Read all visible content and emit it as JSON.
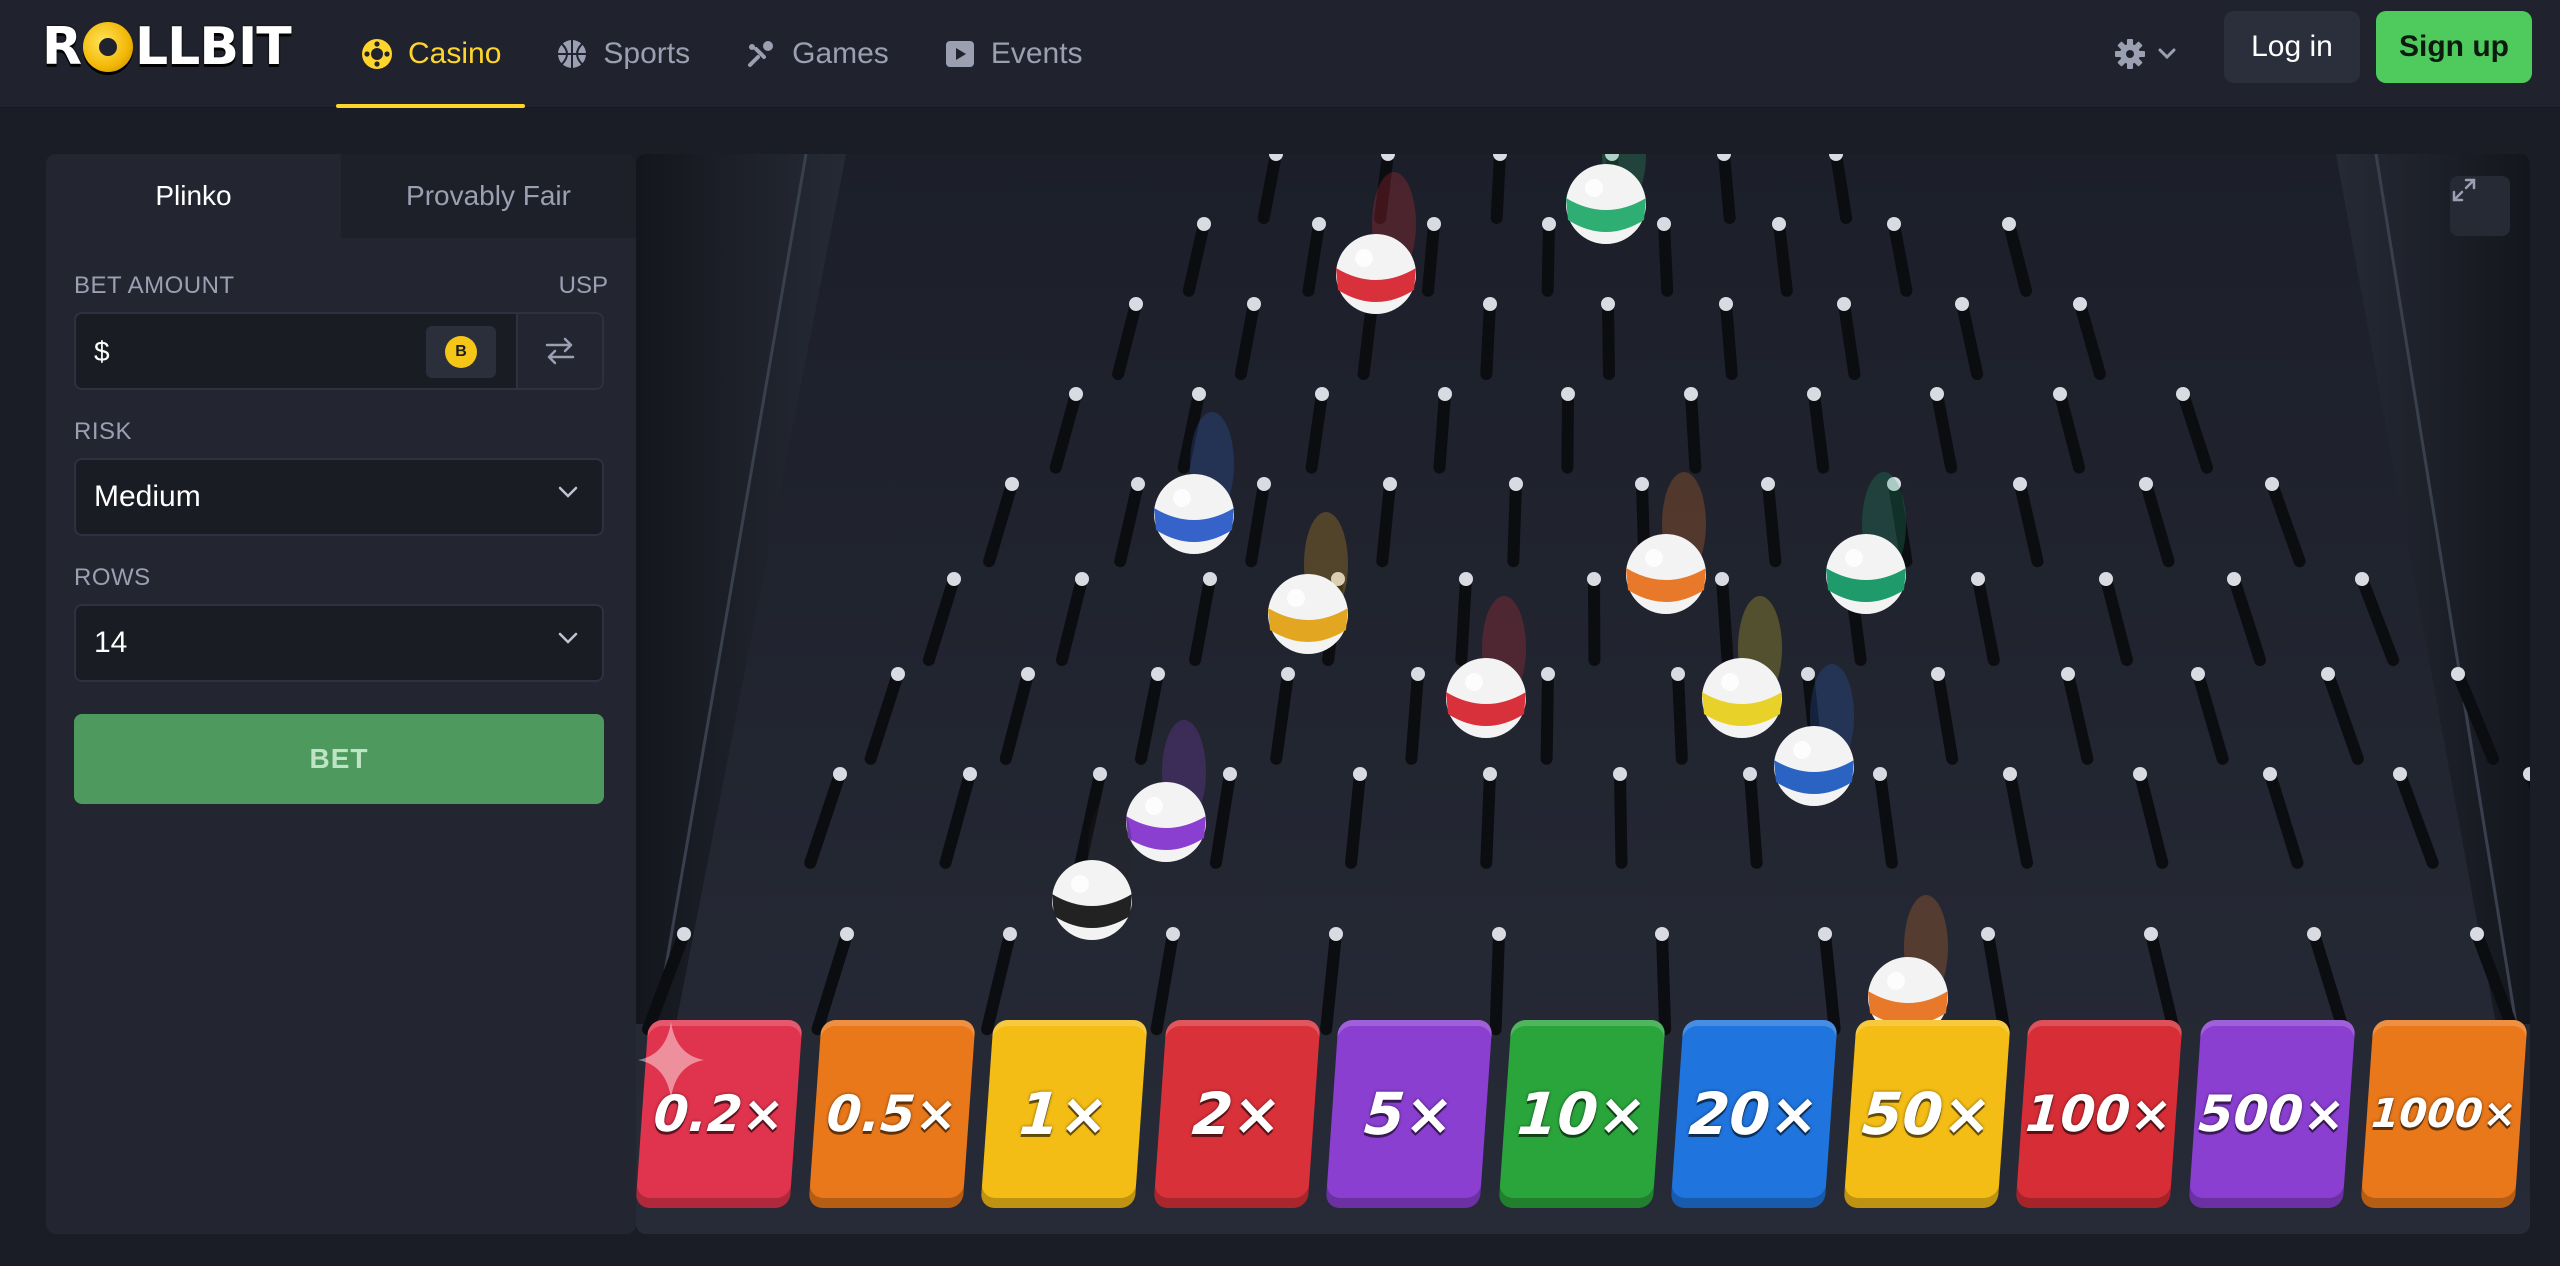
{
  "header": {
    "logo": "ROLLBIT",
    "nav": [
      {
        "label": "Casino",
        "icon": "casino-chip-icon",
        "active": true
      },
      {
        "label": "Sports",
        "icon": "basketball-icon",
        "active": false
      },
      {
        "label": "Games",
        "icon": "games-icon",
        "active": false
      },
      {
        "label": "Events",
        "icon": "events-icon",
        "active": false
      }
    ],
    "settings_icon": "gear-icon",
    "login_label": "Log in",
    "signup_label": "Sign up"
  },
  "panel": {
    "tabs": [
      {
        "label": "Plinko",
        "active": true
      },
      {
        "label": "Provably Fair",
        "active": false
      }
    ],
    "bet_amount_label": "BET AMOUNT",
    "bet_currency": "USP",
    "bet_prefix": "$",
    "bet_value": "",
    "coin_symbol": "B",
    "risk_label": "RISK",
    "risk_value": "Medium",
    "rows_label": "ROWS",
    "rows_value": "14",
    "bet_button": "BET"
  },
  "game": {
    "multipliers": [
      "0.2×",
      "0.5×",
      "1×",
      "2×",
      "5×",
      "10×",
      "20×",
      "50×",
      "100×",
      "500×",
      "1000×"
    ],
    "bucket_colors": [
      "#e0344e",
      "#e9781a",
      "#f4bd16",
      "#d9313a",
      "#8a3fd1",
      "#2aa53c",
      "#1f74dd",
      "#f4bd16",
      "#d62d36",
      "#8a3fd1",
      "#e9781a"
    ],
    "ball_colors": [
      "#2fae74",
      "#d8313b",
      "#3563c9",
      "#e3a620",
      "#e8782a",
      "#1f9a6a",
      "#d8313b",
      "#e8d22a",
      "#2a63c2",
      "#8a3fd1",
      "#222222",
      "#e8782a"
    ]
  }
}
